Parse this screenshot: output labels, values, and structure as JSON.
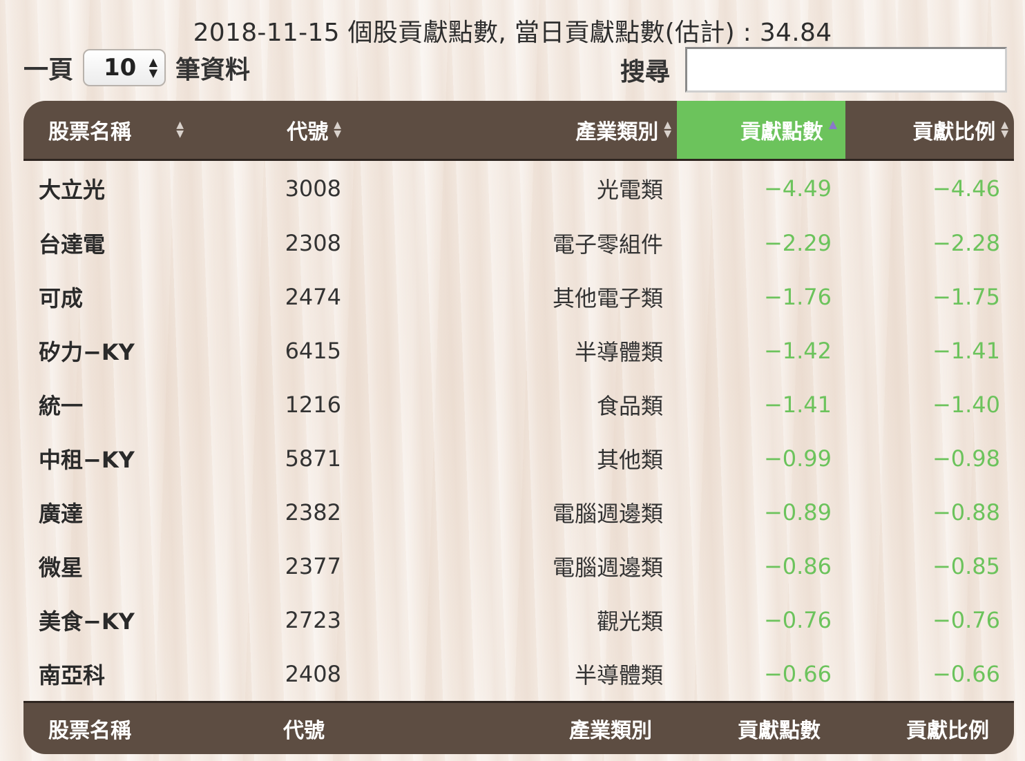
{
  "title": "2018-11-15 個股貢獻點數, 當日貢獻點數(估計) : 34.84",
  "length_control": {
    "prefix": "一頁",
    "value": "10",
    "suffix": "筆資料"
  },
  "search": {
    "label": "搜尋",
    "value": ""
  },
  "colors": {
    "header_bg": "#5d4d42",
    "sorted_header_bg": "#6cc35c",
    "value_text": "#6cc35c"
  },
  "table": {
    "headers": [
      "股票名稱",
      "代號",
      "產業類別",
      "貢獻點數",
      "貢獻比例"
    ],
    "sorted_column": "貢獻點數",
    "sort_direction": "ascending",
    "rows": [
      {
        "name": "大立光",
        "code": "3008",
        "industry": "光電類",
        "points": "−4.49",
        "ratio": "−4.46"
      },
      {
        "name": "台達電",
        "code": "2308",
        "industry": "電子零組件",
        "points": "−2.29",
        "ratio": "−2.28"
      },
      {
        "name": "可成",
        "code": "2474",
        "industry": "其他電子類",
        "points": "−1.76",
        "ratio": "−1.75"
      },
      {
        "name": "矽力−KY",
        "code": "6415",
        "industry": "半導體類",
        "points": "−1.42",
        "ratio": "−1.41"
      },
      {
        "name": "統一",
        "code": "1216",
        "industry": "食品類",
        "points": "−1.41",
        "ratio": "−1.40"
      },
      {
        "name": "中租−KY",
        "code": "5871",
        "industry": "其他類",
        "points": "−0.99",
        "ratio": "−0.98"
      },
      {
        "name": "廣達",
        "code": "2382",
        "industry": "電腦週邊類",
        "points": "−0.89",
        "ratio": "−0.88"
      },
      {
        "name": "微星",
        "code": "2377",
        "industry": "電腦週邊類",
        "points": "−0.86",
        "ratio": "−0.85"
      },
      {
        "name": "美食−KY",
        "code": "2723",
        "industry": "觀光類",
        "points": "−0.76",
        "ratio": "−0.76"
      },
      {
        "name": "南亞科",
        "code": "2408",
        "industry": "半導體類",
        "points": "−0.66",
        "ratio": "−0.66"
      }
    ],
    "footers": [
      "股票名稱",
      "代號",
      "產業類別",
      "貢獻點數",
      "貢獻比例"
    ]
  }
}
